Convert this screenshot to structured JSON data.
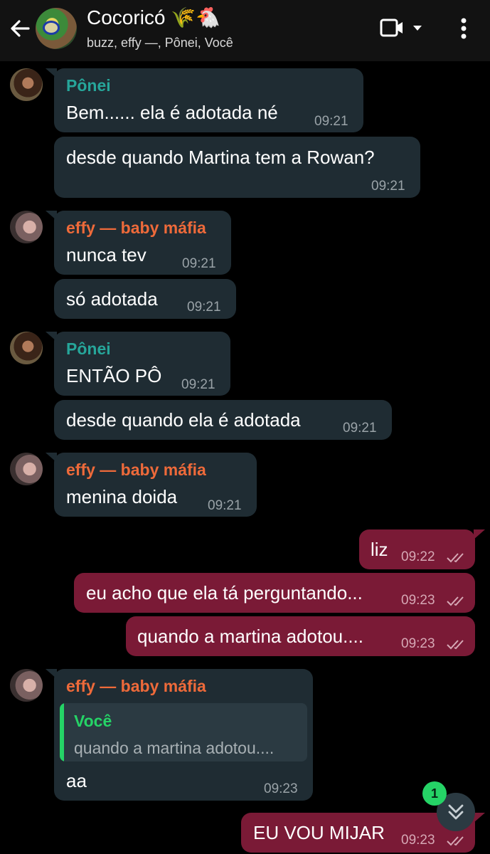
{
  "header": {
    "title": "Cocoricó 🌾🐔",
    "subtitle": "buzz, effy —, Pônei, Você"
  },
  "colors": {
    "background": "#000000",
    "incoming_bubble": "#1f2c33",
    "outgoing_bubble": "#7a1a36",
    "sender_ponei": "#26a69a",
    "sender_effy": "#ee6a3a",
    "quote_accent": "#25d366"
  },
  "messages": [
    {
      "sender": "Pônei",
      "text": "Bem...... ela é adotada né",
      "time": "09:21"
    },
    {
      "text": "desde quando Martina tem a Rowan?",
      "time": "09:21"
    },
    {
      "sender": "effy — baby máfia",
      "text": "nunca tev",
      "time": "09:21"
    },
    {
      "text": "só adotada",
      "time": "09:21"
    },
    {
      "sender": "Pônei",
      "text": "ENTÃO PÔ",
      "time": "09:21"
    },
    {
      "text": "desde quando ela é adotada",
      "time": "09:21"
    },
    {
      "sender": "effy — baby máfia",
      "text": "menina doida",
      "time": "09:21"
    },
    {
      "text": "liz",
      "time": "09:22"
    },
    {
      "text": "eu acho que ela tá perguntando...",
      "time": "09:23"
    },
    {
      "text": "quando a martina adotou....",
      "time": "09:23"
    },
    {
      "sender": "effy — baby máfia",
      "quote": {
        "name": "Você",
        "text": "quando a martina adotou...."
      },
      "text": "aa",
      "time": "09:23"
    },
    {
      "text": "EU VOU MIJAR",
      "time": "09:23"
    }
  ],
  "scroll_button": {
    "unread_count": "1"
  },
  "icons": [
    "back-arrow-icon",
    "group-avatar",
    "video-call-icon",
    "dropdown-caret-icon",
    "more-options-icon",
    "double-check-icon",
    "chevrons-down-icon"
  ]
}
